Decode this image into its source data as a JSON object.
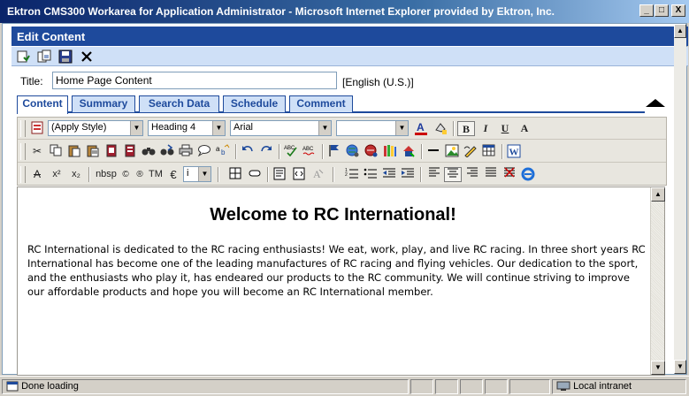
{
  "window": {
    "title": "Ektron CMS300 Workarea for Application Administrator - Microsoft Internet Explorer provided by Ektron, Inc.",
    "controls": {
      "minimize": "_",
      "maximize": "□",
      "close": "X"
    }
  },
  "page": {
    "header": "Edit Content",
    "top_toolbar_icons": [
      "publish-icon",
      "checkin-icon",
      "save-icon",
      "cancel-icon"
    ]
  },
  "form": {
    "title_label": "Title:",
    "title_value": "Home Page Content",
    "language": "[English (U.S.)]"
  },
  "tabs": [
    {
      "label": "Content",
      "active": true
    },
    {
      "label": "Summary",
      "active": false
    },
    {
      "label": "Search Data",
      "active": false
    },
    {
      "label": "Schedule",
      "active": false
    },
    {
      "label": "Comment",
      "active": false
    }
  ],
  "editor_toolbar": {
    "style_select": "(Apply Style)",
    "heading_select": "Heading 4",
    "font_select": "Arial",
    "size_select": "",
    "bold": "B",
    "italic": "I",
    "underline": "U",
    "font_a": "A",
    "strike": "A",
    "sup": "x²",
    "sub": "x₂",
    "nbsp": "nbsp",
    "copyright": "©",
    "registered": "®",
    "trademark": "TM",
    "euro": "€",
    "symbol_select": "i"
  },
  "content": {
    "heading": "Welcome to RC International!",
    "body": "RC International is dedicated to the RC racing enthusiasts! We eat, work, play, and live RC racing. In three short years RC International has become one of the leading manufactures of RC racing and flying vehicles. Our dedication to the sport, and the enthusiasts who play it, has endeared our products to the RC community. We will continue striving to improve our affordable products and hope you will become an RC International member."
  },
  "status": {
    "text": "Done loading",
    "zone": "Local intranet"
  }
}
